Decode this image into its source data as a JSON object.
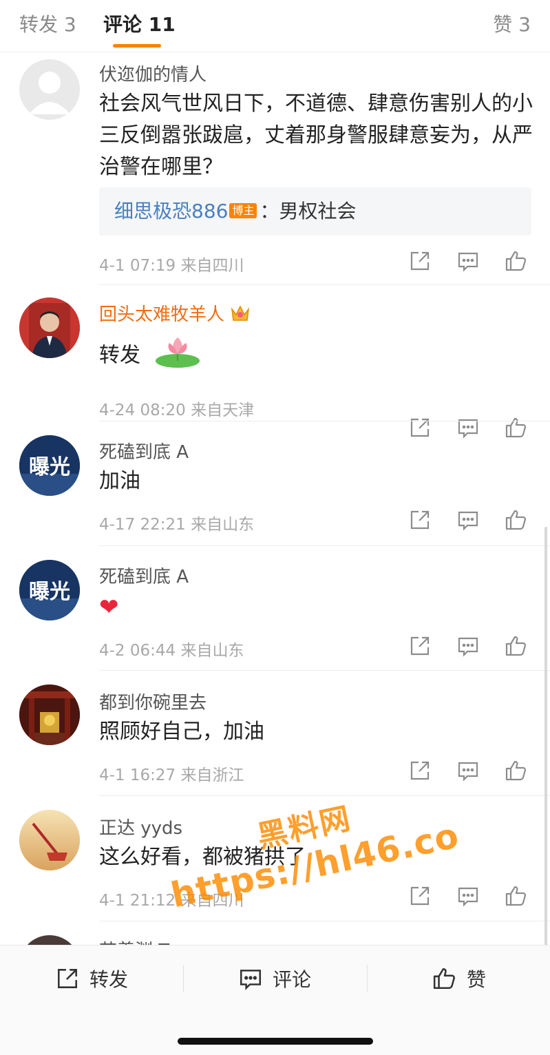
{
  "tabs": {
    "repost": "转发 3",
    "comment": "评论 11",
    "like": "赞 3"
  },
  "comments": [
    {
      "username": "伏迩伽的情人",
      "text": "社会风气世风日下，不道德、肆意伤害别人的小三反倒嚣张跋扈，丈着那身警服肆意妄为，从严治警在哪里？",
      "reply": {
        "name": "细思极恐886",
        "badge": "博主",
        "text": "：男权社会"
      },
      "meta": "4-1 07:19 来自四川",
      "avatar": "default-avatar"
    },
    {
      "username": "回头太难牧羊人",
      "text": "转发",
      "emoji": "lotus-emoji",
      "crown": "vip-crown-icon",
      "meta": "4-24 08:20 来自天津",
      "avatar": "police-photo-avatar"
    },
    {
      "username": "死磕到底 A",
      "text": "加油",
      "avatar_text": "曝光",
      "meta": "4-17 22:21 来自山东"
    },
    {
      "username": "死磕到底 A",
      "text": "❤",
      "avatar_text": "曝光",
      "meta": "4-2 06:44 来自山东"
    },
    {
      "username": "都到你碗里去",
      "text": "照顾好自己，加油",
      "meta": "4-1 16:27 来自浙江",
      "avatar": "temple-avatar"
    },
    {
      "username": "正达 yyds",
      "text": "这么好看，都被猪拱了",
      "meta": "4-1 21:12 来自四川",
      "avatar": "sunset-avatar"
    },
    {
      "username": "苗羡渊 Tower",
      "partial": true
    }
  ],
  "bottom_bar": {
    "share": "转发",
    "comment": "评论",
    "like": "赞"
  },
  "watermark": {
    "line1": "黑料网",
    "line2": "https://hl46.co"
  },
  "colors": {
    "accent": "#ff8200",
    "link": "#4a7fbf",
    "vip_name": "#f56b0e"
  }
}
